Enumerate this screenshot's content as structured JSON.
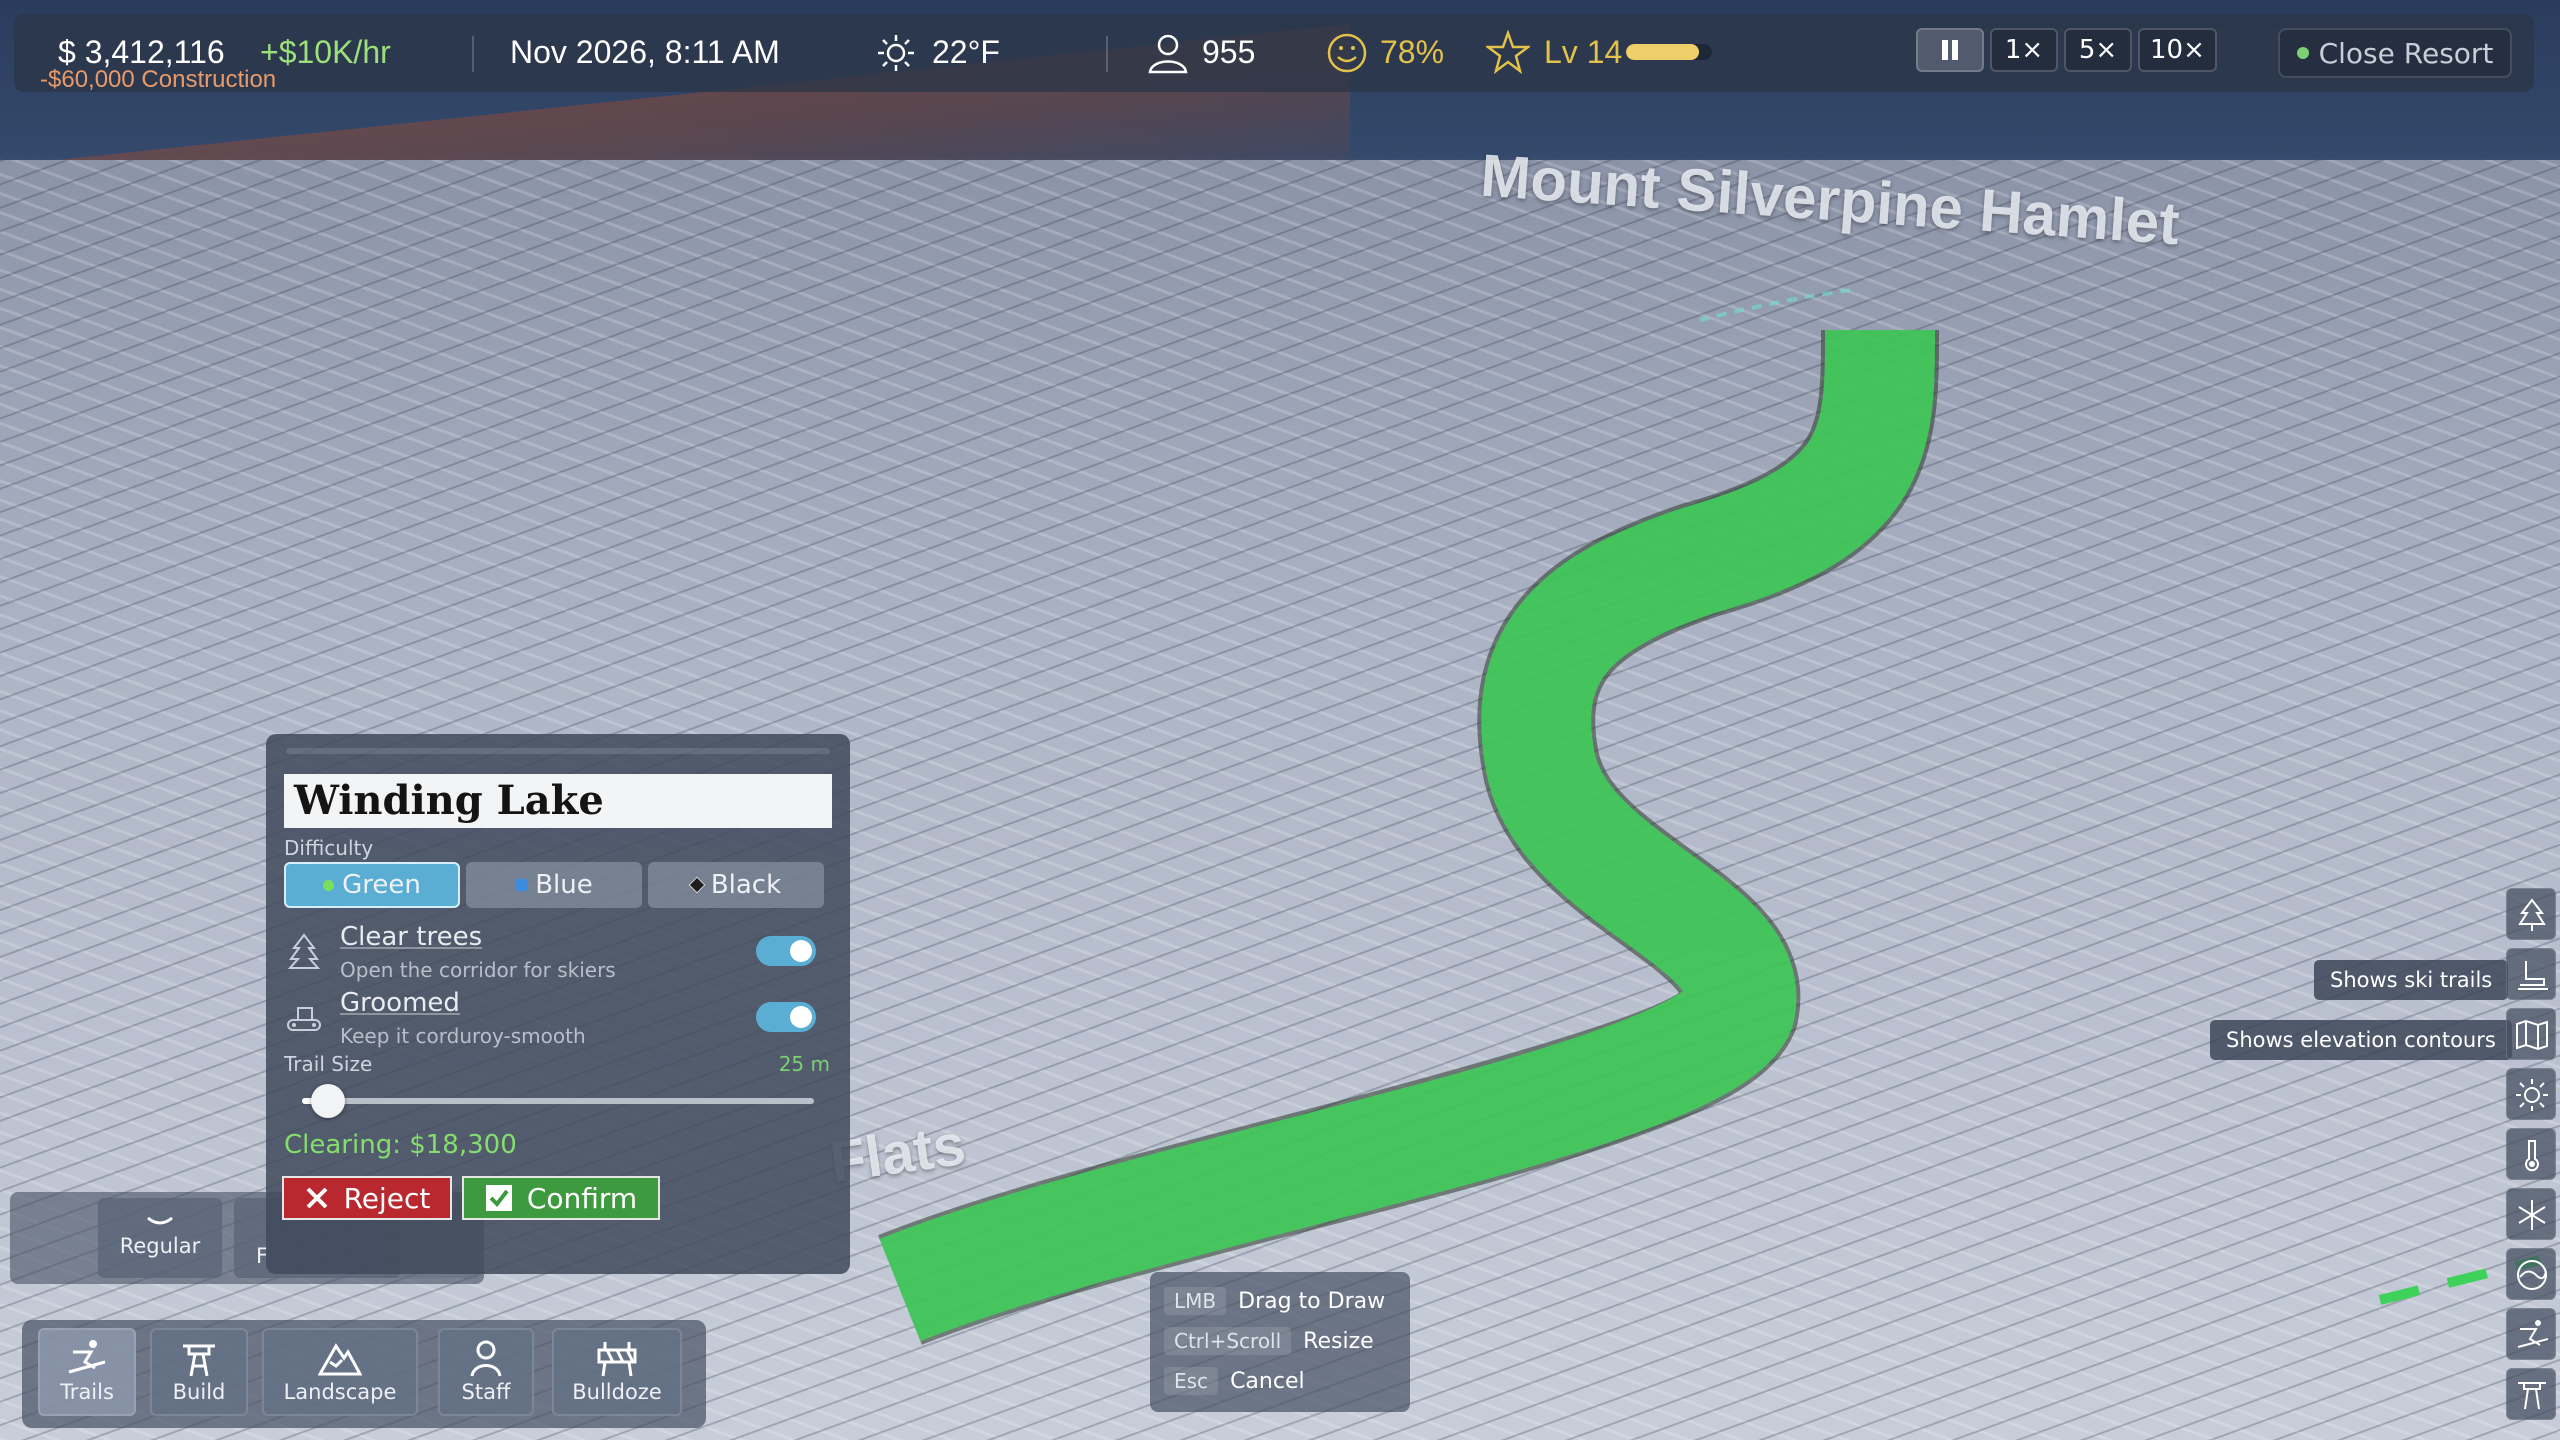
{
  "map": {
    "label_hamlet": "Mount Silverpine Hamlet",
    "label_flats": "Flats"
  },
  "status": {
    "money": "$ 3,412,116",
    "income": "+$10K/hr",
    "construction": "-$60,000 Construction",
    "date": "Nov 2026, 8:11 AM",
    "temperature": "22°F",
    "guests": "955",
    "happiness": "78%",
    "level": "Lv 14",
    "xp_fraction": 0.85
  },
  "speed": {
    "pause_icon": "pause-icon",
    "options": [
      "1×",
      "5×",
      "10×"
    ]
  },
  "close_resort": "Close Resort",
  "panel": {
    "trail_name": "Winding Lake",
    "difficulty_label": "Difficulty",
    "difficulties": [
      "Green",
      "Blue",
      "Black"
    ],
    "selected_difficulty": "Green",
    "clear_trees": {
      "title": "Clear trees",
      "subtitle": "Open the corridor for skiers",
      "on": true
    },
    "groomed": {
      "title": "Groomed",
      "subtitle": "Keep it corduroy-smooth",
      "on": true
    },
    "size_label": "Trail Size",
    "size_value": "25 m",
    "size_fraction": 0.05,
    "clearing": "Clearing: $18,300",
    "reject": "Reject",
    "confirm": "Confirm"
  },
  "subbar": {
    "regular": "Regular",
    "freeride_partial": "F",
    "other_partial": "..."
  },
  "toolbar": {
    "trails": "Trails",
    "build": "Build",
    "landscape": "Landscape",
    "staff": "Staff",
    "bulldoze": "Bulldoze"
  },
  "hints": {
    "lmb_key": "LMB",
    "lmb_action": "Drag to Draw",
    "ctrl_key": "Ctrl+Scroll",
    "ctrl_action": "Resize",
    "esc_key": "Esc",
    "esc_action": "Cancel"
  },
  "tooltips": {
    "trails": "Shows ski trails",
    "contours": "Shows elevation contours"
  },
  "colors": {
    "trail_overlay": "#3fd25a",
    "accent": "#5aaed3",
    "reject": "#b8282e",
    "confirm": "#3d9a3e"
  }
}
